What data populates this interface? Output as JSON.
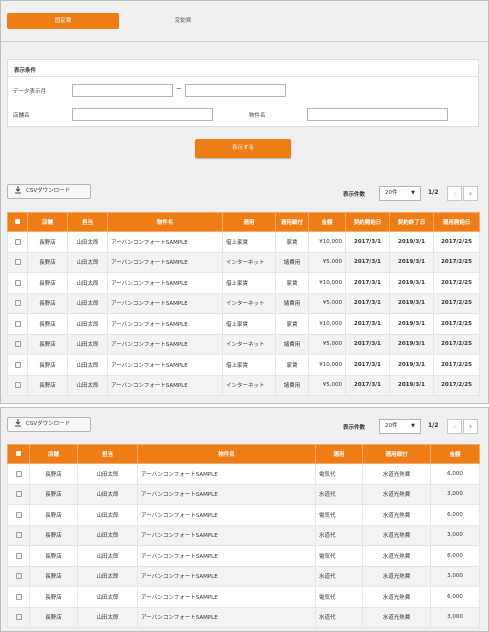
{
  "tabs": [
    {
      "label": "固定費",
      "active": true
    },
    {
      "label": "変動費",
      "active": false
    }
  ],
  "filter": {
    "title": "表示条件",
    "date_label": "データ表示月",
    "date_from": "",
    "date_to": "",
    "range_sep": "~",
    "store_label": "店舗名",
    "store_value": "",
    "property_label": "物件名",
    "property_value": "",
    "search_label": "表示する"
  },
  "colors": {
    "accent": "#ee7d16",
    "panel_bg": "#f0f0f0"
  },
  "table1": {
    "csv_label": "CSVダウンロード",
    "per_page_label": "表示件数",
    "per_page_value": "20件",
    "page_info": "1/2",
    "columns": [
      "",
      "店舗",
      "担当",
      "物件名",
      "適用",
      "適用細付",
      "金額",
      "契約開始日",
      "契約終了日",
      "運用開始日"
    ],
    "rows": [
      [
        "長野店",
        "山田太郎",
        "アーバンコンフォートSAMPLE",
        "借上家賃",
        "家賃",
        "¥10,000",
        "2017/3/1",
        "2019/3/1",
        "2017/2/25"
      ],
      [
        "長野店",
        "山田太郎",
        "アーバンコンフォートSAMPLE",
        "インターネット",
        "諸費用",
        "¥5,000",
        "2017/3/1",
        "2019/3/1",
        "2017/2/25"
      ],
      [
        "長野店",
        "山田太郎",
        "アーバンコンフォートSAMPLE",
        "借上家賃",
        "家賃",
        "¥10,000",
        "2017/3/1",
        "2019/3/1",
        "2017/2/25"
      ],
      [
        "長野店",
        "山田太郎",
        "アーバンコンフォートSAMPLE",
        "インターネット",
        "諸費用",
        "¥5,000",
        "2017/3/1",
        "2019/3/1",
        "2017/2/25"
      ],
      [
        "長野店",
        "山田太郎",
        "アーバンコンフォートSAMPLE",
        "借上家賃",
        "家賃",
        "¥10,000",
        "2017/3/1",
        "2019/3/1",
        "2017/2/25"
      ],
      [
        "長野店",
        "山田太郎",
        "アーバンコンフォートSAMPLE",
        "インターネット",
        "諸費用",
        "¥5,000",
        "2017/3/1",
        "2019/3/1",
        "2017/2/25"
      ],
      [
        "長野店",
        "山田太郎",
        "アーバンコンフォートSAMPLE",
        "借上家賃",
        "家賃",
        "¥10,000",
        "2017/3/1",
        "2019/3/1",
        "2017/2/25"
      ],
      [
        "長野店",
        "山田太郎",
        "アーバンコンフォートSAMPLE",
        "インターネット",
        "諸費用",
        "¥5,000",
        "2017/3/1",
        "2019/3/1",
        "2017/2/25"
      ]
    ]
  },
  "table2": {
    "csv_label": "CSVダウンロード",
    "per_page_label": "表示件数",
    "per_page_value": "20件",
    "page_info": "1/2",
    "columns": [
      "",
      "店舗",
      "担当",
      "物件名",
      "適用",
      "適用細付",
      "金額"
    ],
    "rows": [
      [
        "長野店",
        "山田太郎",
        "アーバンコンフォートSAMPLE",
        "電気代",
        "水道光熱費",
        "6,000"
      ],
      [
        "長野店",
        "山田太郎",
        "アーバンコンフォートSAMPLE",
        "水道代",
        "水道光熱費",
        "3,000"
      ],
      [
        "長野店",
        "山田太郎",
        "アーバンコンフォートSAMPLE",
        "電気代",
        "水道光熱費",
        "6,000"
      ],
      [
        "長野店",
        "山田太郎",
        "アーバンコンフォートSAMPLE",
        "水道代",
        "水道光熱費",
        "3,000"
      ],
      [
        "長野店",
        "山田太郎",
        "アーバンコンフォートSAMPLE",
        "電気代",
        "水道光熱費",
        "6,000"
      ],
      [
        "長野店",
        "山田太郎",
        "アーバンコンフォートSAMPLE",
        "水道代",
        "水道光熱費",
        "3,000"
      ],
      [
        "長野店",
        "山田太郎",
        "アーバンコンフォートSAMPLE",
        "電気代",
        "水道光熱費",
        "6,000"
      ],
      [
        "長野店",
        "山田太郎",
        "アーバンコンフォートSAMPLE",
        "水道代",
        "水道光熱費",
        "3,000"
      ]
    ]
  }
}
